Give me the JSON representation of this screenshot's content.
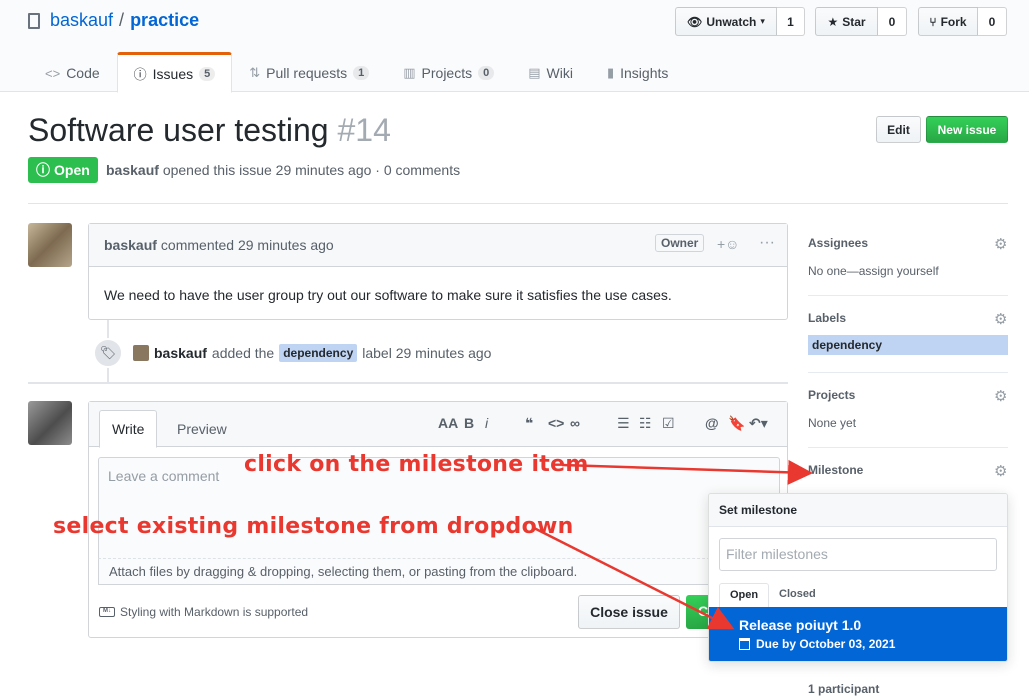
{
  "repo": {
    "owner": "baskauf",
    "separator": "/",
    "name": "practice"
  },
  "actions": {
    "watch_label": "Unwatch",
    "watch_count": "1",
    "star_label": "Star",
    "star_count": "0",
    "fork_label": "Fork",
    "fork_count": "0"
  },
  "tabs": [
    {
      "label": "Code",
      "icon": "code-icon"
    },
    {
      "label": "Issues",
      "count": "5",
      "icon": "issue-opened-icon"
    },
    {
      "label": "Pull requests",
      "count": "1",
      "icon": "git-pull-request-icon"
    },
    {
      "label": "Projects",
      "count": "0",
      "icon": "project-icon"
    },
    {
      "label": "Wiki",
      "icon": "book-icon"
    },
    {
      "label": "Insights",
      "icon": "graph-icon"
    }
  ],
  "issue": {
    "title": "Software user testing",
    "number": "#14",
    "state": "Open",
    "author": "baskauf",
    "meta_rest": "opened this issue 29 minutes ago · 0 comments",
    "edit_label": "Edit",
    "new_issue_label": "New issue"
  },
  "comment": {
    "author": "baskauf",
    "time": "commented 29 minutes ago",
    "owner_badge": "Owner",
    "body": "We need to have the user group try out our software to make sure it satisfies the use cases."
  },
  "event": {
    "actor": "baskauf",
    "text_before": "added the",
    "label": "dependency",
    "text_after": "label 29 minutes ago"
  },
  "new_comment": {
    "write_tab": "Write",
    "preview_tab": "Preview",
    "placeholder": "Leave a comment",
    "attach_text": "Attach files by dragging & dropping, selecting them, or pasting from the clipboard.",
    "markdown_note": "Styling with Markdown is supported",
    "close_label": "Close issue",
    "comment_peek": "C"
  },
  "sidebar": {
    "assignees": {
      "heading": "Assignees",
      "value": "No one—assign yourself"
    },
    "labels": {
      "heading": "Labels",
      "label": "dependency"
    },
    "projects": {
      "heading": "Projects",
      "value": "None yet"
    },
    "milestone": {
      "heading": "Milestone"
    },
    "participants": "1 participant"
  },
  "milestone_popup": {
    "title": "Set milestone",
    "filter_placeholder": "Filter milestones",
    "tab_open": "Open",
    "tab_closed": "Closed",
    "item_title": "Release poiuyt 1.0",
    "item_due": "Due by October 03, 2021"
  },
  "annotations": {
    "milestone_hint": "click on the milestone item",
    "dropdown_hint": "select existing milestone from dropdown",
    "color": "#e8382f"
  },
  "colors": {
    "link": "#0366d6",
    "open_green": "#2cbe4e",
    "selected_blue": "#0366d6",
    "label_bg": "#bfd4f2",
    "tab_accent": "#e36209"
  }
}
